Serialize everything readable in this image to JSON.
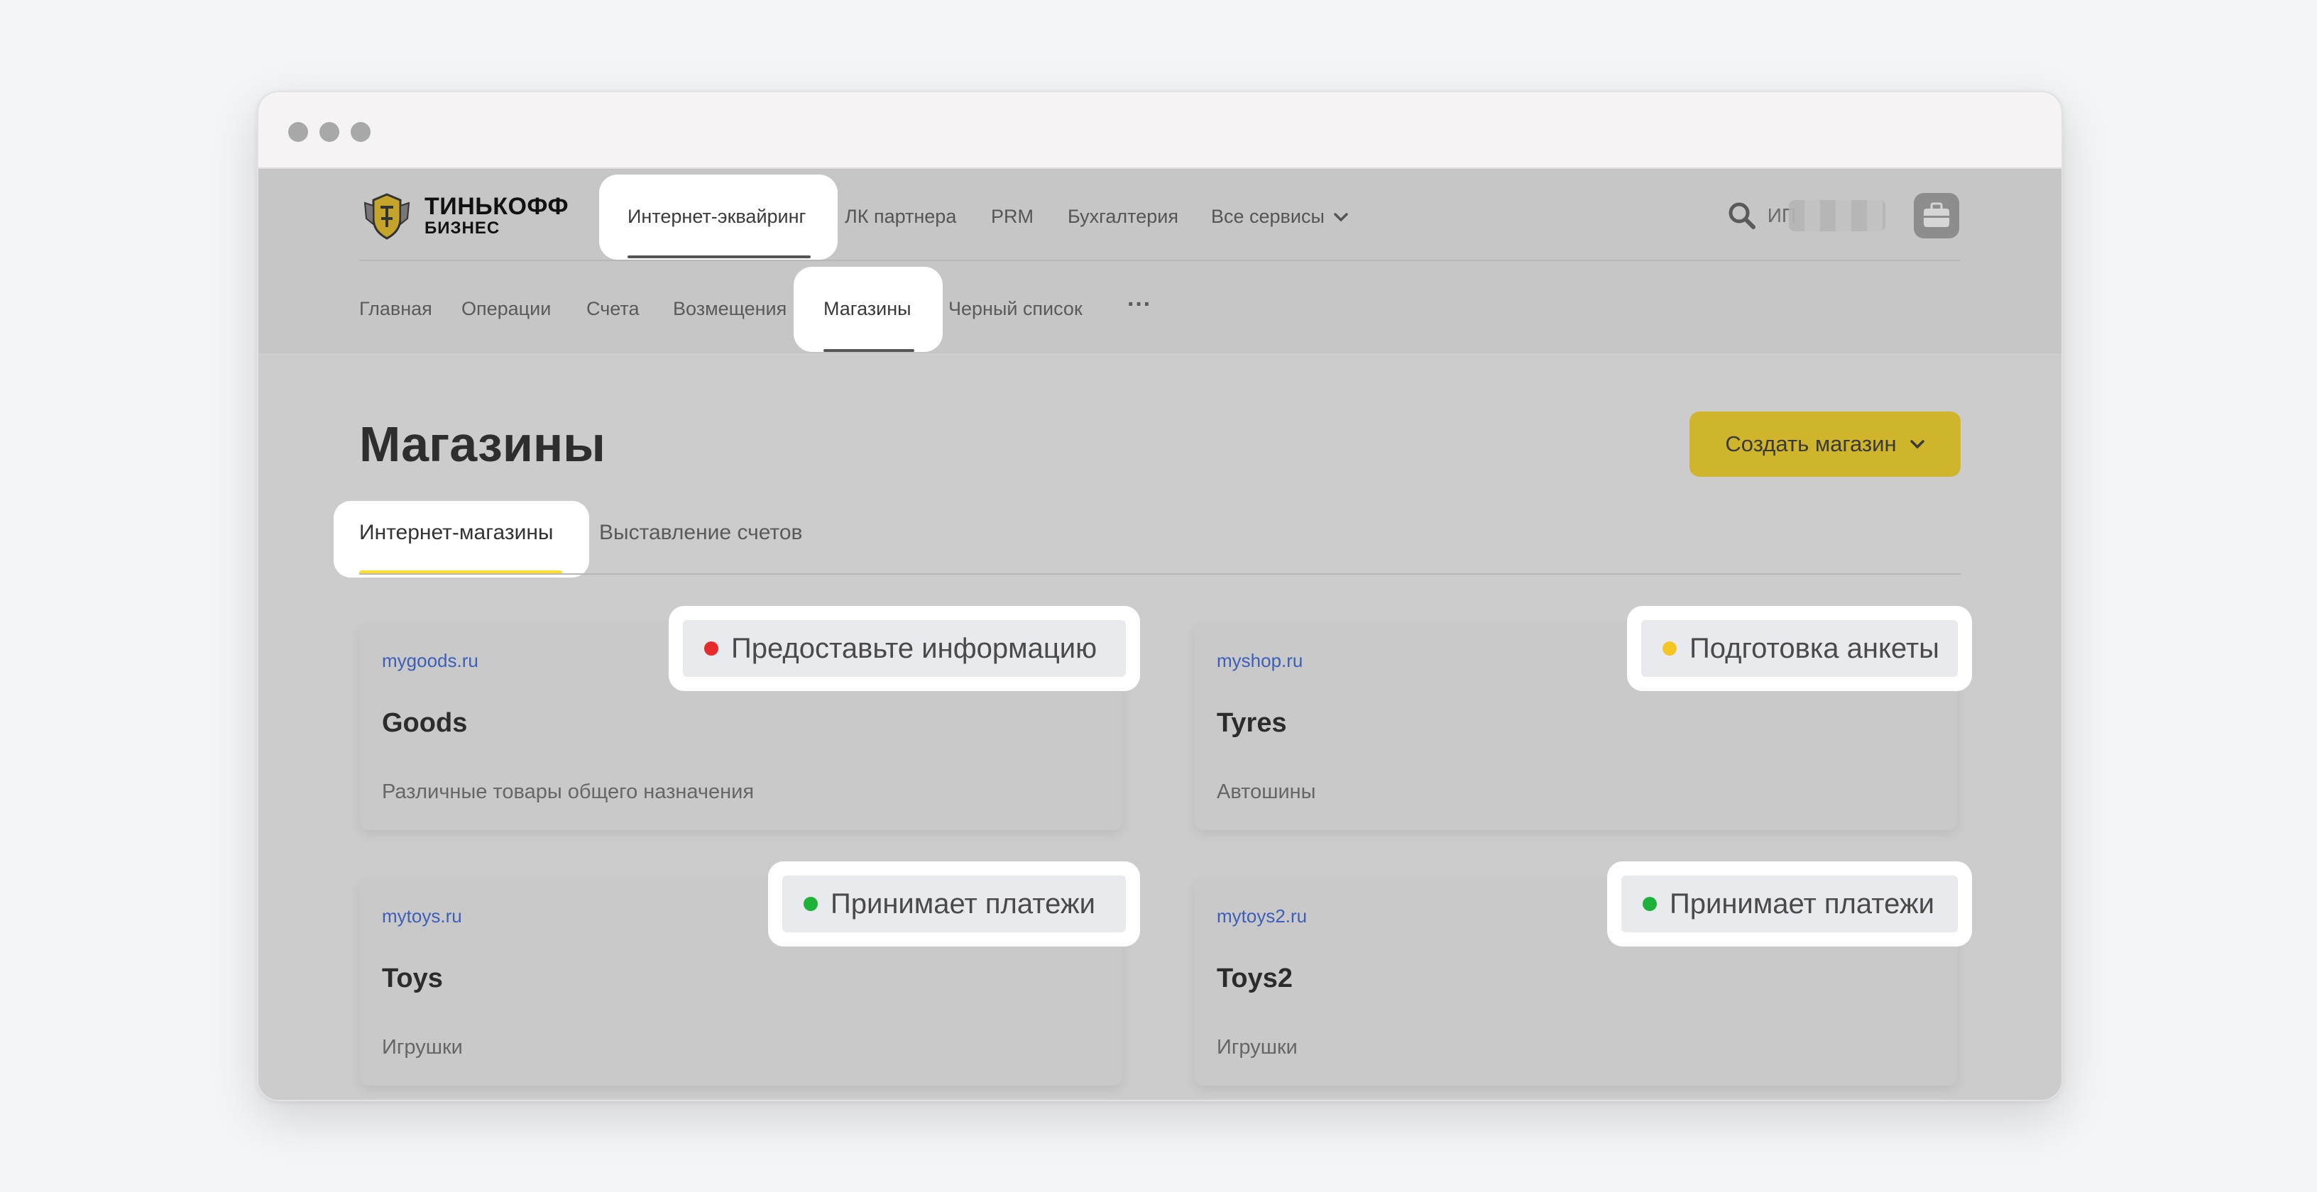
{
  "brand": {
    "line1": "ТИНЬКОФФ",
    "line2": "БИЗНЕС"
  },
  "topnav": {
    "items": [
      "Интернет-эквайринг",
      "ЛК партнера",
      "PRM",
      "Бухгалтерия",
      "Все сервисы"
    ],
    "user_label": "ИП"
  },
  "subnav": {
    "items": [
      "Главная",
      "Операции",
      "Счета",
      "Возмещения",
      "Магазины",
      "Черный список"
    ],
    "more": "···"
  },
  "page": {
    "title": "Магазины",
    "create_button": "Создать магазин",
    "tabs": [
      "Интернет-магазины",
      "Выставление счетов"
    ]
  },
  "shops": [
    {
      "domain": "mygoods.ru",
      "name": "Goods",
      "description": "Различные товары общего назначения",
      "status": "Предоставьте информацию",
      "status_color": "#e52b2b"
    },
    {
      "domain": "myshop.ru",
      "name": "Tyres",
      "description": "Автошины",
      "status": "Подготовка анкеты",
      "status_color": "#f3c623"
    },
    {
      "domain": "mytoys.ru",
      "name": "Toys",
      "description": "Игрушки",
      "status": "Принимает платежи",
      "status_color": "#1fb23a"
    },
    {
      "domain": "mytoys2.ru",
      "name": "Toys2",
      "description": "Игрушки",
      "status": "Принимает платежи",
      "status_color": "#1fb23a"
    }
  ],
  "colors": {
    "accent_yellow": "#cfb52c",
    "link_blue": "#3e5fb8",
    "tab_underline": "#ffdd2d"
  }
}
